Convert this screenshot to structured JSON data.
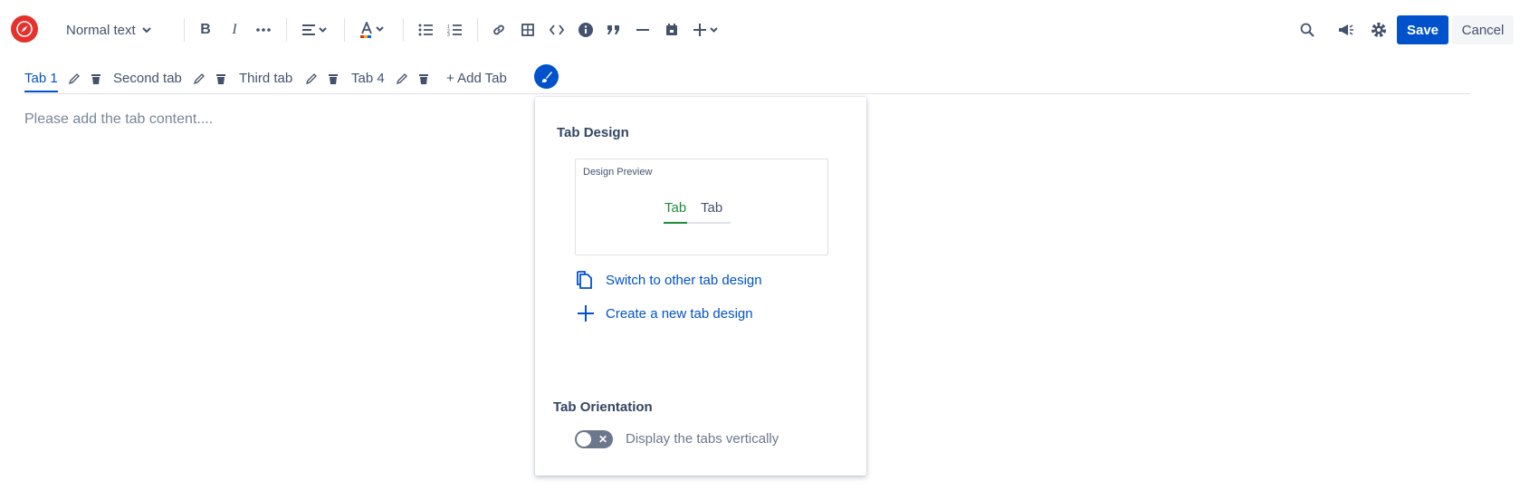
{
  "toolbar": {
    "text_style": "Normal text",
    "save_label": "Save",
    "cancel_label": "Cancel",
    "icons": [
      "bold-icon",
      "italic-icon",
      "more-formatting-icon",
      "align-icon",
      "text-color-icon",
      "bullet-list-icon",
      "numbered-list-icon",
      "link-icon",
      "table-icon",
      "code-icon",
      "info-icon",
      "quote-icon",
      "divider-icon",
      "date-icon",
      "insert-icon",
      "search-icon",
      "feedback-icon",
      "settings-icon"
    ],
    "accent_color": "#0052cc"
  },
  "tabs": {
    "items": [
      {
        "label": "Tab 1",
        "active": true
      },
      {
        "label": "Second tab",
        "active": false
      },
      {
        "label": "Third tab",
        "active": false
      },
      {
        "label": "Tab 4",
        "active": false
      }
    ],
    "add_label": "+ Add Tab"
  },
  "content": {
    "placeholder": "Please add the tab content...."
  },
  "popup": {
    "design_title": "Tab Design",
    "preview_label": "Design Preview",
    "preview_tabs": [
      {
        "label": "Tab",
        "color": "#1f8a3a"
      },
      {
        "label": "Tab",
        "color": "#42526e"
      }
    ],
    "switch_label": "Switch to other tab design",
    "create_label": "Create a new tab design",
    "orientation_title": "Tab Orientation",
    "toggle_label": "Display the tabs vertically",
    "toggle_on": false
  }
}
